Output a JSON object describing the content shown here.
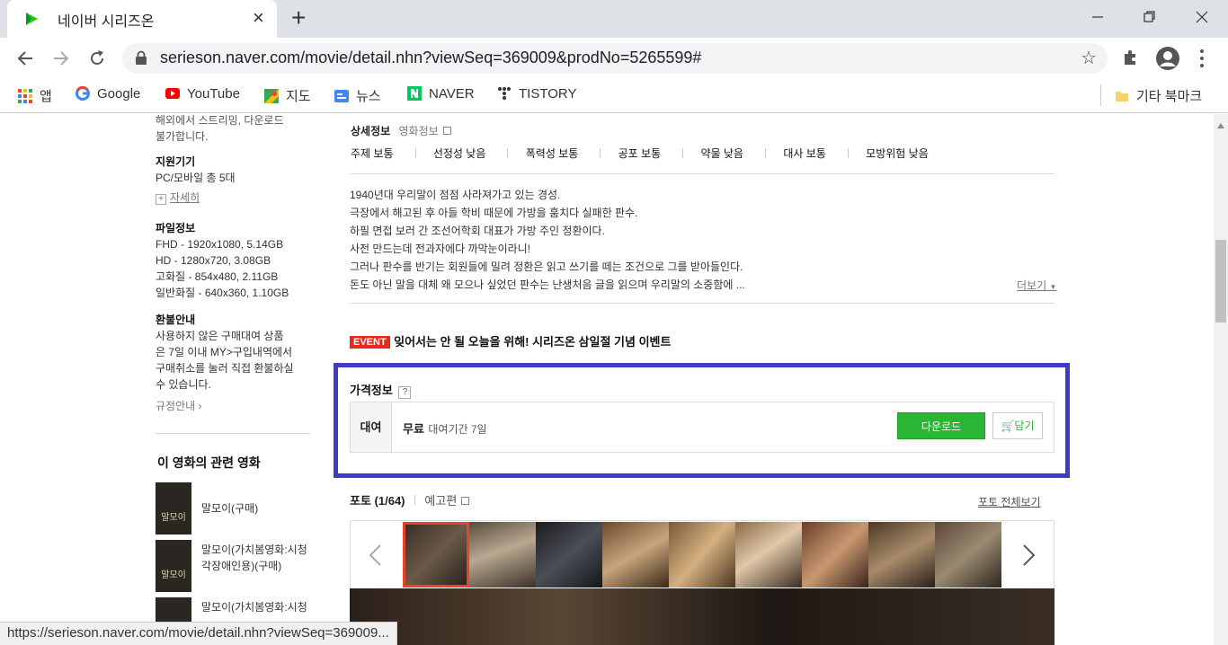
{
  "browser": {
    "tab_title": "네이버 시리즈온",
    "tab_close": "×",
    "new_tab": "+",
    "url": "serieson.naver.com/movie/detail.nhn?viewSeq=369009&prodNo=5265599#",
    "status_url": "https://serieson.naver.com/movie/detail.nhn?viewSeq=369009...",
    "bookmarks": [
      "앱",
      "Google",
      "YouTube",
      "지도",
      "뉴스",
      "NAVER",
      "TISTORY"
    ],
    "other_bookmarks": "기타 북마크"
  },
  "sidebar": {
    "note_line1": "해외에서 스트리밍, 다운로드",
    "note_line2": "불가합니다.",
    "devices_title": "지원기기",
    "devices_value": "PC/모바일 총 5대",
    "more": "자세히",
    "file_title": "파일정보",
    "files": [
      "FHD - 1920x1080, 5.14GB",
      "HD - 1280x720, 3.08GB",
      "고화질 - 854x480, 2.11GB",
      "일반화질 - 640x360, 1.10GB"
    ],
    "refund_title": "환불안내",
    "refund_lines": [
      "사용하지 않은 구매대여 상품",
      "은 7일 이내 MY>구입내역에서",
      "구매취소를 눌러 직접 환불하실",
      "수 있습니다."
    ],
    "policy": "규정안내",
    "related_title": "이 영화의 관련 영화",
    "related": [
      "말모이(구매)",
      "말모이(가치봄영화:시청",
      "각장애인용)(구매)",
      "말모이(가치봄영화:시청"
    ],
    "poster_text": "말모이"
  },
  "detail": {
    "title": "상세정보",
    "movie_info": "영화정보",
    "tags": [
      "주제 보통",
      "선정성 낮음",
      "폭력성 보통",
      "공포 보통",
      "약물 낮음",
      "대사 보통",
      "모방위험 낮음"
    ],
    "desc": [
      "1940년대 우리말이 점점 사라져가고 있는 경성.",
      "극장에서 해고된 후 아들 학비 때문에 가방을 훔치다 실패한 판수.",
      "하필 면접 보러 간 조선어학회 대표가 가방 주인 정환이다.",
      "사전 만드는데 전과자에다 까막눈이라니!",
      "그러나 판수를 반기는 회원들에 밀려 정환은 읽고 쓰기를 떼는 조건으로 그를 받아들인다.",
      "돈도 아닌 말을 대체 왜 모으나 싶었던 판수는 난생처음 글을 읽으며 우리말의 소중함에 ..."
    ],
    "more": "더보기"
  },
  "event": {
    "badge": "EVENT",
    "text": "잊어서는 안 될 오늘을 위해! 시리즈온 삼일절 기념 이벤트"
  },
  "price": {
    "title": "가격정보",
    "help": "?",
    "type": "대여",
    "amount": "무료",
    "period": "대여기간 7일",
    "download": "다운로드",
    "cart": "담기"
  },
  "photos": {
    "label": "포토",
    "count": "(1/64)",
    "trailer": "예고편",
    "all": "포토 전체보기"
  },
  "colors": {
    "green": "#2bb534",
    "highlight": "#3c3cc8",
    "event": "#e8281e",
    "selected": "#e8442a"
  }
}
